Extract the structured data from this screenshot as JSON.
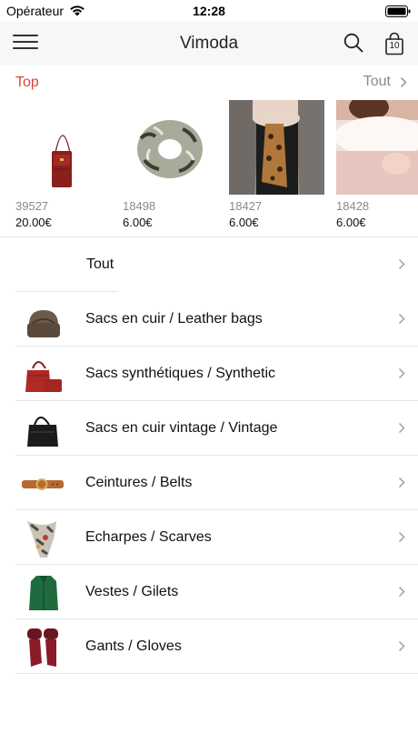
{
  "status_bar": {
    "carrier": "Opérateur",
    "time": "12:28"
  },
  "nav": {
    "title": "Vimoda",
    "cart_count": "10"
  },
  "top": {
    "label": "Top",
    "see_all": "Tout",
    "products": [
      {
        "ref": "39527",
        "price": "20.00€"
      },
      {
        "ref": "18498",
        "price": "6.00€"
      },
      {
        "ref": "18427",
        "price": "6.00€"
      },
      {
        "ref": "18428",
        "price": "6.00€"
      }
    ]
  },
  "categories": {
    "all_label": "Tout",
    "items": [
      {
        "label": "Sacs en cuir / Leather bags"
      },
      {
        "label": "Sacs synthétiques / Synthetic"
      },
      {
        "label": "Sacs en cuir vintage / Vintage"
      },
      {
        "label": "Ceintures / Belts"
      },
      {
        "label": "Echarpes / Scarves"
      },
      {
        "label": "Vestes / Gilets"
      },
      {
        "label": "Gants / Gloves"
      }
    ]
  },
  "colors": {
    "accent": "#e0413a",
    "muted": "#8a8a8a"
  }
}
